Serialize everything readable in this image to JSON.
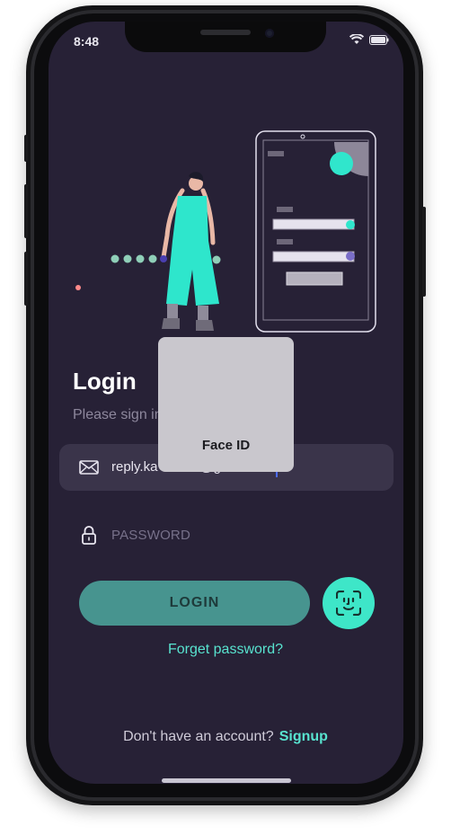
{
  "status_bar": {
    "time": "8:48"
  },
  "login": {
    "title": "Login",
    "subtitle": "Please sign in",
    "email_value": "reply.ka",
    "email_tail": "@g",
    "password_placeholder": "PASSWORD",
    "login_button": "LOGIN",
    "forgot_password": "Forget password?",
    "signup_question": "Don't have an account?",
    "signup_link": "Signup"
  },
  "face_id": {
    "label": "Face ID"
  },
  "icons": {
    "email": "envelope-icon",
    "password": "lock-icon",
    "face_id": "face-id-icon"
  },
  "colors": {
    "background": "#272136",
    "accent": "#3ee6c8",
    "login_button": "#47948f",
    "input_bg": "#3a344a"
  }
}
